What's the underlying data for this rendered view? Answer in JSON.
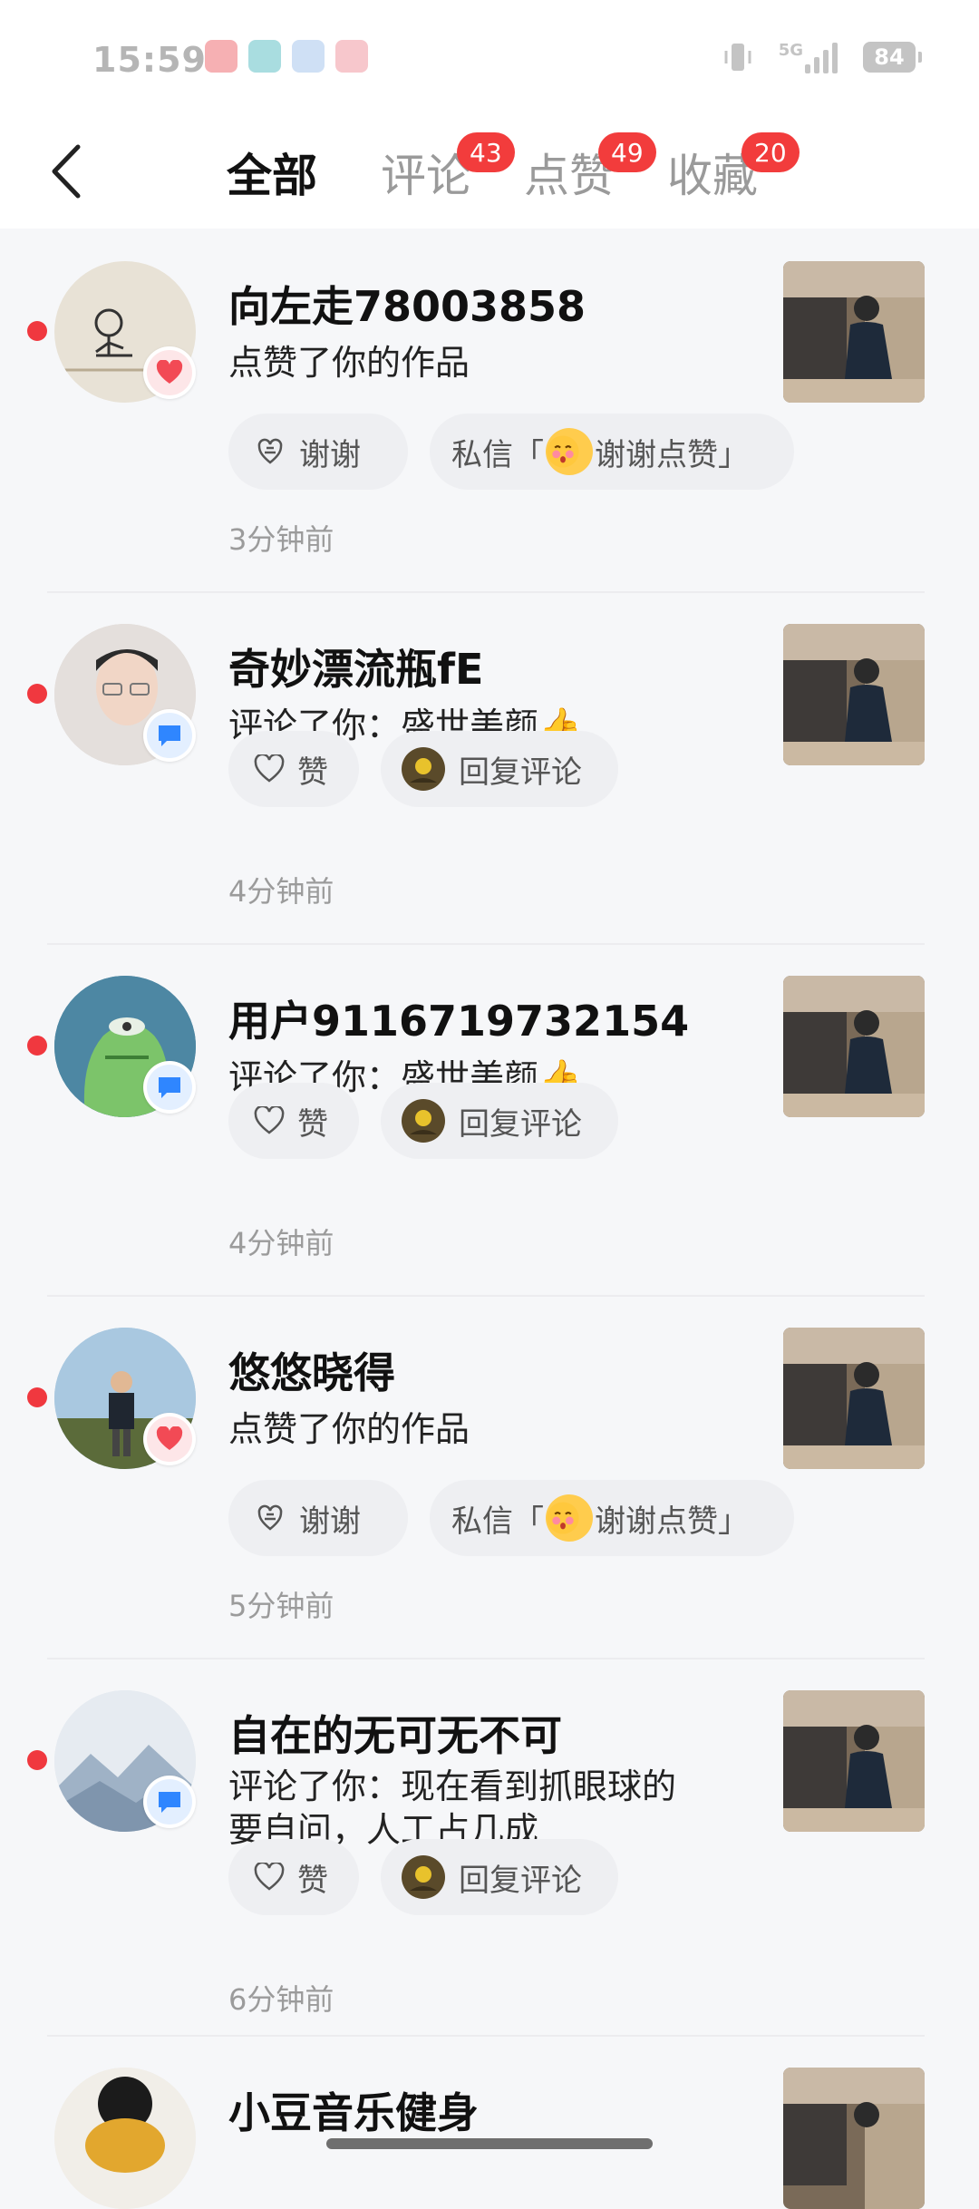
{
  "status_bar": {
    "time": "15:59",
    "network": "5G",
    "battery": "84",
    "colors": {
      "time": "#b5b5b5",
      "icons": "#c4c4c4"
    }
  },
  "header": {
    "tabs": [
      {
        "label": "全部",
        "badge": ""
      },
      {
        "label": "评论",
        "badge": "43"
      },
      {
        "label": "点赞",
        "badge": "49"
      },
      {
        "label": "收藏",
        "badge": "20"
      }
    ]
  },
  "notifications": [
    {
      "name": "向左走78003858",
      "action_line1": "点赞了你的作品",
      "action_line2": "",
      "type": "like",
      "buttons": [
        {
          "label": "谢谢",
          "icon": "thanks-icon"
        },
        {
          "prefix": "私信「",
          "label": "谢谢点赞",
          "suffix": "」",
          "icon": "blush-emoji-icon"
        }
      ],
      "time": "3分钟前"
    },
    {
      "name": "奇妙漂流瓶fE",
      "action_line1": "评论了你：盛世美颜👍",
      "action_line2": "",
      "type": "comment",
      "buttons": [
        {
          "label": "赞",
          "icon": "heart-outline-icon"
        },
        {
          "label": "回复评论",
          "icon": "user-avatar-icon"
        }
      ],
      "time": "4分钟前"
    },
    {
      "name": "用户9116719732154",
      "action_line1": "评论了你：盛世美颜👍",
      "action_line2": "",
      "type": "comment",
      "buttons": [
        {
          "label": "赞",
          "icon": "heart-outline-icon"
        },
        {
          "label": "回复评论",
          "icon": "user-avatar-icon"
        }
      ],
      "time": "4分钟前"
    },
    {
      "name": "悠悠晓得",
      "action_line1": "点赞了你的作品",
      "action_line2": "",
      "type": "like",
      "buttons": [
        {
          "label": "谢谢",
          "icon": "thanks-icon"
        },
        {
          "prefix": "私信「",
          "label": "谢谢点赞",
          "suffix": "」",
          "icon": "blush-emoji-icon"
        }
      ],
      "time": "5分钟前"
    },
    {
      "name": "自在的无可无不可",
      "action_line1": "评论了你：现在看到抓眼球的",
      "action_line2": "要自问，人工占几成",
      "type": "comment",
      "buttons": [
        {
          "label": "赞",
          "icon": "heart-outline-icon"
        },
        {
          "label": "回复评论",
          "icon": "user-avatar-icon"
        }
      ],
      "time": "6分钟前"
    },
    {
      "name": "小豆音乐健身",
      "action_line1": "",
      "action_line2": "",
      "type": "partial",
      "buttons": [],
      "time": ""
    }
  ],
  "colors": {
    "accent_red": "#f23c3c",
    "unread_dot": "#f0383f",
    "like_badge": "#f24a55",
    "comment_badge": "#2f86ff"
  }
}
